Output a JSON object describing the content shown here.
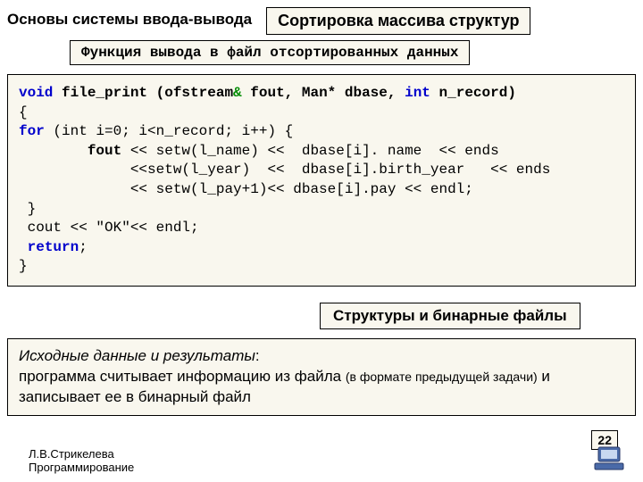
{
  "header": {
    "left_title": "Основы системы ввода-вывода",
    "right_title": "Сортировка массива структур",
    "subtitle": "Функция вывода в файл отсортированных данных"
  },
  "code": {
    "kw_void": "void",
    "fn": " file_print (ofstream",
    "amp": "&",
    "args1": " fout, Man* dbase, ",
    "kw_int": "int",
    "args2": " n_record)",
    "brace_open": "{",
    "for_kw": "for",
    "for_rest": " (int i=0; i<n_record; i++) {",
    "l1a": "        ",
    "l1_fout": "fout",
    "l1b": " << setw(l_name) <<  dbase[i]. name  << ends",
    "l2": "             <<setw(l_year)  <<  dbase[i].birth_year   << ends",
    "l3": "             << setw(l_pay+1)<< dbase[i].pay << endl;",
    "brace_close1": " }",
    "cout_line": " cout << \"OK\"<< endl;",
    "kw_return": "return",
    "semi": ";",
    "brace_close2": "}"
  },
  "section2": {
    "title": "Структуры и бинарные файлы",
    "desc_lead": "Исходные данные и результаты",
    "desc_rest1": ":",
    "desc_line2a": "программа считывает информацию из файла ",
    "desc_paren": "(в формате предыдущей задачи)",
    "desc_line2b": " и",
    "desc_line3": "записывает ее в бинарный файл"
  },
  "footer": {
    "author": "Л.В.Стрикелева",
    "course": "Программирование"
  },
  "page": "22"
}
